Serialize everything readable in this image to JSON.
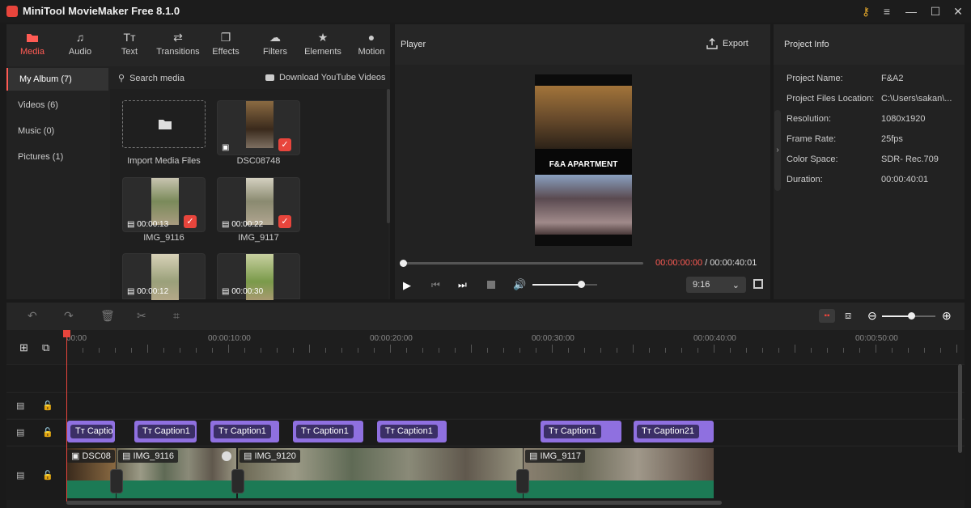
{
  "app": {
    "title": "MiniTool MovieMaker Free 8.1.0"
  },
  "tabs": [
    {
      "label": "Media",
      "icon": "folder-icon"
    },
    {
      "label": "Audio",
      "icon": "music-note-icon"
    },
    {
      "label": "Text",
      "icon": "text-icon"
    },
    {
      "label": "Transitions",
      "icon": "transitions-icon"
    },
    {
      "label": "Effects",
      "icon": "effects-icon"
    },
    {
      "label": "Filters",
      "icon": "filters-icon"
    },
    {
      "label": "Elements",
      "icon": "elements-icon"
    },
    {
      "label": "Motion",
      "icon": "motion-icon"
    }
  ],
  "sidebar": {
    "items": [
      {
        "label": "My Album (7)"
      },
      {
        "label": "Videos (6)"
      },
      {
        "label": "Music (0)"
      },
      {
        "label": "Pictures (1)"
      }
    ]
  },
  "media": {
    "search_placeholder": "Search media",
    "download_label": "Download YouTube Videos",
    "items": [
      {
        "name": "Import Media Files",
        "duration": ""
      },
      {
        "name": "DSC08748",
        "duration": ""
      },
      {
        "name": "IMG_9116",
        "duration": "00:00:13"
      },
      {
        "name": "IMG_9117",
        "duration": "00:00:22"
      },
      {
        "name": "",
        "duration": "00:00:12"
      },
      {
        "name": "",
        "duration": "00:00:30"
      }
    ]
  },
  "player": {
    "title": "Player",
    "export_label": "Export",
    "overlay_text": "F&A  APARTMENT",
    "current_time": "00:00:00:00",
    "separator": " / ",
    "total_time": "00:00:40:01",
    "aspect": "9:16",
    "volume": 0.75,
    "progress": 0.0
  },
  "project_info": {
    "title": "Project Info",
    "rows": [
      {
        "label": "Project Name:",
        "value": "F&A2"
      },
      {
        "label": "Project Files Location:",
        "value": "C:\\Users\\sakan\\..."
      },
      {
        "label": "Resolution:",
        "value": "1080x1920"
      },
      {
        "label": "Frame Rate:",
        "value": "25fps"
      },
      {
        "label": "Color Space:",
        "value": "SDR- Rec.709"
      },
      {
        "label": "Duration:",
        "value": "00:00:40:01"
      }
    ]
  },
  "timeline": {
    "ruler": [
      "00:00",
      "00:00:10:00",
      "00:00:20:00",
      "00:00:30:00",
      "00:00:40:00",
      "00:00:50:00"
    ],
    "captions": [
      "Captio",
      "Caption1",
      "Caption1",
      "Caption1",
      "Caption1",
      "Caption1",
      "Caption21"
    ],
    "clips": [
      "DSC08",
      "IMG_9116",
      "IMG_9120",
      "IMG_9117"
    ],
    "zoom": 0.55
  },
  "colors": {
    "accent": "#ff5b54",
    "caption": "#8f70e0",
    "audio": "#1c7a55",
    "playhead": "#e8453c"
  }
}
